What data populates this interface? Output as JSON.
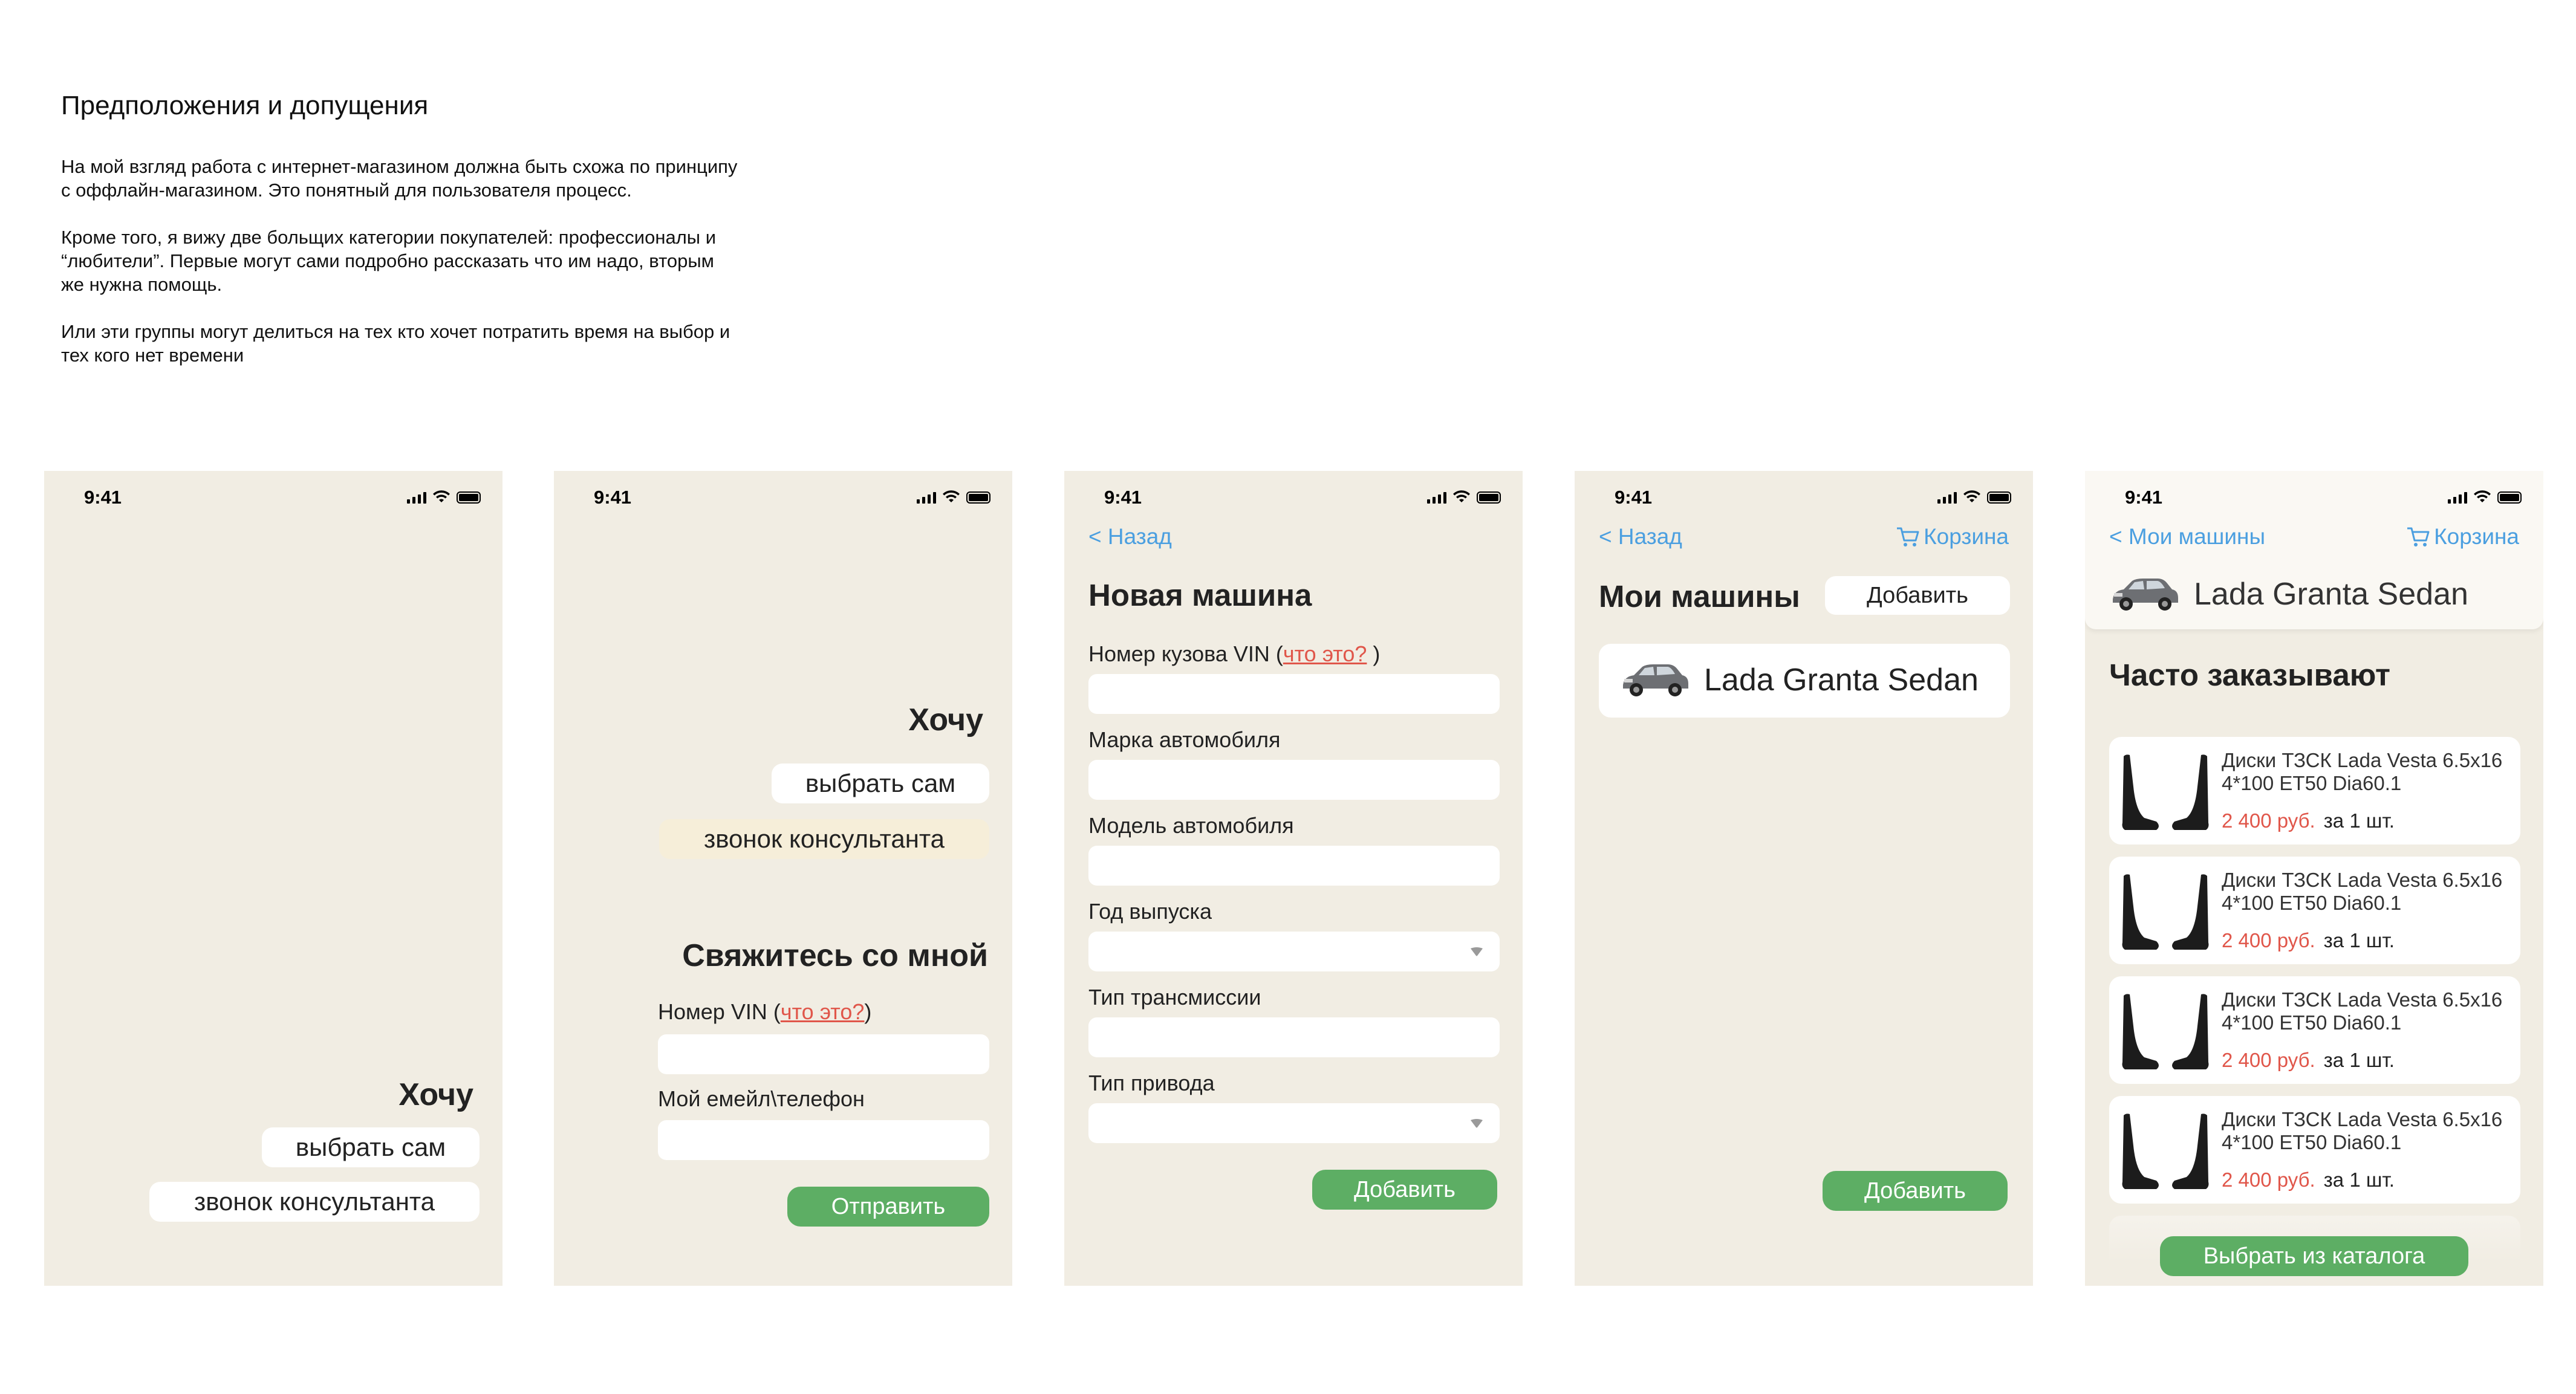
{
  "intro": {
    "title": "Предположения и допущения",
    "p1": "На мой взгляд работа с интернет-магазином должна быть схожа по принципу с оффлайн-магазином. Это понятный для пользователя процесс.",
    "p2": "Кроме того, я вижу две больщих категории покупателей: профессионалы и “любители”. Первые могут сами подробно рассказать что им надо, вторым же нужна помощь.",
    "p3": "Или эти группы могут делиться на тех кто хочет потратить время на выбор и тех кого нет времени"
  },
  "status_time": "9:41",
  "icons": {
    "signal": "cellular-signal-icon",
    "wifi": "wifi-icon",
    "battery": "battery-icon",
    "cart": "cart-icon",
    "car": "car-thumbnail",
    "chevron": "chevron-down-icon"
  },
  "colors": {
    "background": "#f1ede3",
    "accent": "#5dae64",
    "link": "#4b9fe0",
    "price": "#e0564a",
    "cream": "#f6eed9"
  },
  "screen1": {
    "heading": "Хочу",
    "choose_self": "выбрать сам",
    "call_consultant": "звонок консультанта"
  },
  "screen2": {
    "heading": "Хочу",
    "choose_self": "выбрать сам",
    "call_consultant": "звонок консультанта",
    "contact_title": "Свяжитесь со мной",
    "vin_label": "Номер VIN (",
    "vin_link": "что это?",
    "vin_close": ")",
    "contact_label": "Мой емейл\\телефон",
    "submit": "Отправить"
  },
  "screen3": {
    "back": "< Назад",
    "title": "Новая машина",
    "vin_label": "Номер кузова VIN (",
    "vin_link": "что это?",
    "vin_close": " )",
    "brand_label": "Марка автомобиля",
    "model_label": "Модель автомобиля",
    "year_label": "Год выпуска",
    "transmission_label": "Тип трансмиссии",
    "drive_label": "Тип привода",
    "add": "Добавить"
  },
  "screen4": {
    "back": "< Назад",
    "cart": "Корзина",
    "title": "Мои машины",
    "add_top": "Добавить",
    "car_name": "Lada Granta Sedan",
    "add_bottom": "Добавить"
  },
  "screen5": {
    "back": "< Мои машины",
    "cart": "Корзина",
    "car_name": "Lada Granta Sedan",
    "section_title": "Часто заказывают",
    "products": [
      {
        "name": "Диски ТЗСК Lada Vesta 6.5x16 4*100 ET50 Dia60.1",
        "price": "2 400 руб.",
        "unit": "за 1 шт."
      },
      {
        "name": "Диски ТЗСК Lada Vesta 6.5x16 4*100 ET50 Dia60.1",
        "price": "2 400 руб.",
        "unit": "за 1 шт."
      },
      {
        "name": "Диски ТЗСК Lada Vesta 6.5x16 4*100 ET50 Dia60.1",
        "price": "2 400 руб.",
        "unit": "за 1 шт."
      },
      {
        "name": "Диски ТЗСК Lada Vesta 6.5x16 4*100 ET50 Dia60.1",
        "price": "2 400 руб.",
        "unit": "за 1 шт."
      }
    ],
    "catalog_button": "Выбрать из каталога"
  }
}
